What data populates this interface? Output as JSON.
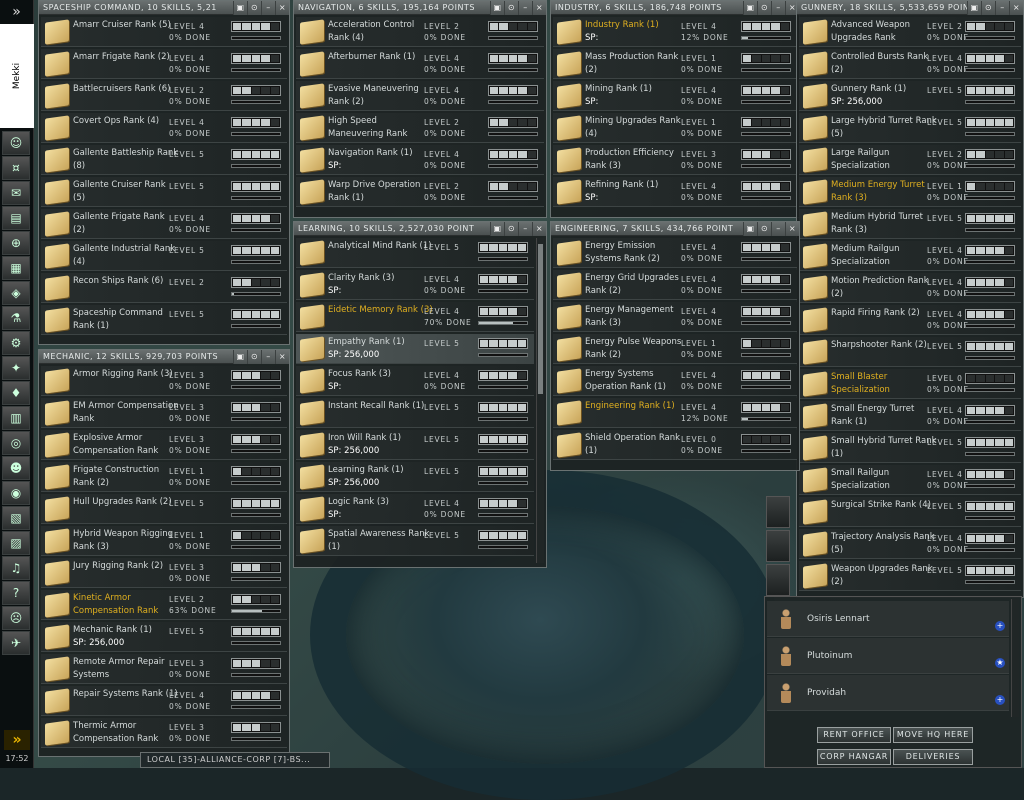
{
  "sidebar": {
    "expand_label": "»",
    "character": "Mekki",
    "clock": "17:52",
    "icons": [
      "character-sheet-icon",
      "wallet-icon",
      "mail-icon",
      "notepad-icon",
      "map-icon",
      "assets-icon",
      "market-icon",
      "science-icon",
      "fitting-icon",
      "contracts-icon",
      "corporation-icon",
      "calculator-icon",
      "help-ring-icon",
      "people-icon",
      "browser-icon",
      "journal-icon",
      "journal2-icon",
      "audio-icon",
      "help-icon",
      "portrait-icon",
      "ship-icon"
    ]
  },
  "windows": {
    "spaceship": {
      "title": "SPACESHIP COMMAND, 10 SKILLS, 5,21",
      "skills": [
        {
          "name": "Amarr Cruiser Rank (5)",
          "level": "LEVEL 4",
          "done": "0% DONE",
          "lv": 4,
          "pct": 0
        },
        {
          "name": "Amarr Frigate Rank (2)",
          "level": "LEVEL 4",
          "done": "0% DONE",
          "lv": 4,
          "pct": 0
        },
        {
          "name": "Battlecruisers Rank (6)",
          "level": "LEVEL 2",
          "done": "0% DONE",
          "lv": 2,
          "pct": 0
        },
        {
          "name": "Covert Ops Rank (4)",
          "level": "LEVEL 4",
          "done": "0% DONE",
          "lv": 4,
          "pct": 0
        },
        {
          "name": "Gallente Battleship Rank (8)",
          "level": "LEVEL 5",
          "done": "",
          "lv": 5,
          "pct": 0
        },
        {
          "name": "Gallente Cruiser Rank (5)",
          "level": "LEVEL 5",
          "done": "",
          "lv": 5,
          "pct": 0
        },
        {
          "name": "Gallente Frigate Rank (2)",
          "level": "LEVEL 4",
          "done": "0% DONE",
          "lv": 4,
          "pct": 0
        },
        {
          "name": "Gallente Industrial Rank (4)",
          "level": "LEVEL 5",
          "done": "",
          "lv": 5,
          "pct": 0
        },
        {
          "name": "Recon Ships Rank (6)",
          "level": "LEVEL 2",
          "done": "",
          "lv": 2,
          "pct": 5
        },
        {
          "name": "Spaceship Command Rank (1)",
          "level": "LEVEL 5",
          "done": "",
          "lv": 5,
          "pct": 0
        }
      ]
    },
    "navigation": {
      "title": "NAVIGATION, 6 SKILLS, 195,164 POINTS",
      "skills": [
        {
          "name": "Acceleration Control Rank (4)",
          "level": "LEVEL 2",
          "done": "0% DONE",
          "lv": 2,
          "pct": 0
        },
        {
          "name": "Afterburner Rank (1)",
          "level": "LEVEL 4",
          "done": "0% DONE",
          "lv": 4,
          "pct": 0
        },
        {
          "name": "Evasive Maneuvering Rank (2)",
          "level": "LEVEL 4",
          "done": "0% DONE",
          "lv": 4,
          "pct": 0
        },
        {
          "name": "High Speed Maneuvering Rank",
          "level": "LEVEL 2",
          "done": "0% DONE",
          "lv": 2,
          "pct": 0
        },
        {
          "name": "Navigation Rank (1)",
          "sp": "SP:",
          "level": "LEVEL 4",
          "done": "0% DONE",
          "lv": 4,
          "pct": 0
        },
        {
          "name": "Warp Drive Operation Rank (1)",
          "level": "LEVEL 2",
          "done": "0% DONE",
          "lv": 2,
          "pct": 0
        }
      ]
    },
    "industry": {
      "title": "INDUSTRY, 6 SKILLS, 186,748 POINTS",
      "skills": [
        {
          "name": "Industry Rank (1)",
          "sp": "SP:",
          "level": "LEVEL 4",
          "done": "12% DONE",
          "lv": 4,
          "pct": 12,
          "hl": true
        },
        {
          "name": "Mass Production Rank (2)",
          "level": "LEVEL 1",
          "done": "0% DONE",
          "lv": 1,
          "pct": 0
        },
        {
          "name": "Mining Rank (1)",
          "sp": "SP:",
          "level": "LEVEL 4",
          "done": "0% DONE",
          "lv": 4,
          "pct": 0
        },
        {
          "name": "Mining Upgrades Rank (4)",
          "level": "LEVEL 1",
          "done": "0% DONE",
          "lv": 1,
          "pct": 0
        },
        {
          "name": "Production Efficiency Rank (3)",
          "level": "LEVEL 3",
          "done": "0% DONE",
          "lv": 3,
          "pct": 0
        },
        {
          "name": "Refining Rank (1)",
          "sp": "SP:",
          "level": "LEVEL 4",
          "done": "0% DONE",
          "lv": 4,
          "pct": 0
        }
      ]
    },
    "gunnery": {
      "title": "GUNNERY, 18 SKILLS, 5,533,659 POINTS",
      "skills": [
        {
          "name": "Advanced Weapon Upgrades Rank",
          "level": "LEVEL 2",
          "done": "0% DONE",
          "lv": 2,
          "pct": 0
        },
        {
          "name": "Controlled Bursts Rank (2)",
          "level": "LEVEL 4",
          "done": "0% DONE",
          "lv": 4,
          "pct": 0
        },
        {
          "name": "Gunnery Rank (1)",
          "sp": "SP: 256,000",
          "level": "LEVEL 5",
          "done": "",
          "lv": 5,
          "pct": 0
        },
        {
          "name": "Large Hybrid Turret Rank (5)",
          "level": "LEVEL 5",
          "done": "",
          "lv": 5,
          "pct": 0
        },
        {
          "name": "Large Railgun Specialization",
          "level": "LEVEL 2",
          "done": "0% DONE",
          "lv": 2,
          "pct": 0
        },
        {
          "name": "Medium Energy Turret Rank (3)",
          "level": "LEVEL 1",
          "done": "0% DONE",
          "lv": 1,
          "pct": 0,
          "hl": true
        },
        {
          "name": "Medium Hybrid Turret Rank (3)",
          "level": "LEVEL 5",
          "done": "",
          "lv": 5,
          "pct": 0
        },
        {
          "name": "Medium Railgun Specialization",
          "level": "LEVEL 4",
          "done": "0% DONE",
          "lv": 4,
          "pct": 0
        },
        {
          "name": "Motion Prediction Rank (2)",
          "level": "LEVEL 4",
          "done": "0% DONE",
          "lv": 4,
          "pct": 0
        },
        {
          "name": "Rapid Firing Rank (2)",
          "level": "LEVEL 4",
          "done": "0% DONE",
          "lv": 4,
          "pct": 0
        },
        {
          "name": "Sharpshooter Rank (2)",
          "level": "LEVEL 5",
          "done": "",
          "lv": 5,
          "pct": 0
        },
        {
          "name": "Small Blaster Specialization",
          "level": "LEVEL 0",
          "done": "0% DONE",
          "lv": 0,
          "pct": 0,
          "hl": true
        },
        {
          "name": "Small Energy Turret Rank (1)",
          "level": "LEVEL 4",
          "done": "0% DONE",
          "lv": 4,
          "pct": 0
        },
        {
          "name": "Small Hybrid Turret Rank (1)",
          "level": "LEVEL 5",
          "done": "",
          "lv": 5,
          "pct": 0
        },
        {
          "name": "Small Railgun Specialization",
          "level": "LEVEL 4",
          "done": "0% DONE",
          "lv": 4,
          "pct": 0
        },
        {
          "name": "Surgical Strike Rank (4)",
          "level": "LEVEL 5",
          "done": "",
          "lv": 5,
          "pct": 0
        },
        {
          "name": "Trajectory Analysis Rank (5)",
          "level": "LEVEL 4",
          "done": "0% DONE",
          "lv": 4,
          "pct": 0
        },
        {
          "name": "Weapon Upgrades Rank (2)",
          "level": "LEVEL 5",
          "done": "",
          "lv": 5,
          "pct": 0
        }
      ]
    },
    "learning": {
      "title": "LEARNING, 10 SKILLS, 2,527,030 POINT",
      "skills": [
        {
          "name": "Analytical Mind Rank (1)",
          "level": "LEVEL 5",
          "done": "",
          "lv": 5,
          "pct": 0
        },
        {
          "name": "Clarity Rank (3)",
          "sp": "SP:",
          "level": "LEVEL 4",
          "done": "0% DONE",
          "lv": 4,
          "pct": 0
        },
        {
          "name": "Eidetic Memory Rank (3)",
          "level": "LEVEL 4",
          "done": "70% DONE",
          "lv": 4,
          "pct": 70,
          "hl": true
        },
        {
          "name": "Empathy Rank (1)",
          "sp": "SP: 256,000",
          "level": "LEVEL 5",
          "done": "",
          "lv": 5,
          "pct": 0,
          "sel": true
        },
        {
          "name": "Focus Rank (3)",
          "sp": "SP:",
          "level": "LEVEL 4",
          "done": "0% DONE",
          "lv": 4,
          "pct": 0
        },
        {
          "name": "Instant Recall Rank (1)",
          "level": "LEVEL 5",
          "done": "",
          "lv": 5,
          "pct": 0
        },
        {
          "name": "Iron Will Rank (1)",
          "sp": "SP: 256,000",
          "level": "LEVEL 5",
          "done": "",
          "lv": 5,
          "pct": 0
        },
        {
          "name": "Learning Rank (1)",
          "sp": "SP: 256,000",
          "level": "LEVEL 5",
          "done": "",
          "lv": 5,
          "pct": 0
        },
        {
          "name": "Logic Rank (3)",
          "sp": "SP:",
          "level": "LEVEL 4",
          "done": "0% DONE",
          "lv": 4,
          "pct": 0
        },
        {
          "name": "Spatial Awareness Rank (1)",
          "level": "LEVEL 5",
          "done": "",
          "lv": 5,
          "pct": 0
        }
      ]
    },
    "engineering": {
      "title": "ENGINEERING, 7 SKILLS, 434,766 POINT",
      "skills": [
        {
          "name": "Energy Emission Systems Rank (2)",
          "level": "LEVEL 4",
          "done": "0% DONE",
          "lv": 4,
          "pct": 0
        },
        {
          "name": "Energy Grid Upgrades Rank (2)",
          "level": "LEVEL 4",
          "done": "0% DONE",
          "lv": 4,
          "pct": 0
        },
        {
          "name": "Energy Management Rank (3)",
          "level": "LEVEL 4",
          "done": "0% DONE",
          "lv": 4,
          "pct": 0
        },
        {
          "name": "Energy Pulse Weapons Rank (2)",
          "level": "LEVEL 1",
          "done": "0% DONE",
          "lv": 1,
          "pct": 0
        },
        {
          "name": "Energy Systems Operation Rank (1)",
          "level": "LEVEL 4",
          "done": "0% DONE",
          "lv": 4,
          "pct": 0
        },
        {
          "name": "Engineering Rank (1)",
          "level": "LEVEL 4",
          "done": "12% DONE",
          "lv": 4,
          "pct": 12,
          "hl": true
        },
        {
          "name": "Shield Operation Rank (1)",
          "level": "LEVEL 0",
          "done": "0% DONE",
          "lv": 0,
          "pct": 0
        }
      ]
    },
    "mechanic": {
      "title": "MECHANIC, 12 SKILLS, 929,703 POINTS",
      "skills": [
        {
          "name": "Armor Rigging Rank (3)",
          "level": "LEVEL 3",
          "done": "0% DONE",
          "lv": 3,
          "pct": 0
        },
        {
          "name": "EM Armor Compensation Rank",
          "level": "LEVEL 3",
          "done": "0% DONE",
          "lv": 3,
          "pct": 0
        },
        {
          "name": "Explosive Armor Compensation Rank",
          "level": "LEVEL 3",
          "done": "0% DONE",
          "lv": 3,
          "pct": 0
        },
        {
          "name": "Frigate Construction Rank (2)",
          "level": "LEVEL 1",
          "done": "0% DONE",
          "lv": 1,
          "pct": 0
        },
        {
          "name": "Hull Upgrades Rank (2)",
          "level": "LEVEL 5",
          "done": "",
          "lv": 5,
          "pct": 0
        },
        {
          "name": "Hybrid Weapon Rigging Rank (3)",
          "level": "LEVEL 1",
          "done": "0% DONE",
          "lv": 1,
          "pct": 0
        },
        {
          "name": "Jury Rigging Rank (2)",
          "level": "LEVEL 3",
          "done": "0% DONE",
          "lv": 3,
          "pct": 0
        },
        {
          "name": "Kinetic Armor Compensation Rank",
          "level": "LEVEL 2",
          "done": "63% DONE",
          "lv": 2,
          "pct": 63,
          "hl": true
        },
        {
          "name": "Mechanic Rank (1)",
          "sp": "SP: 256,000",
          "level": "LEVEL 5",
          "done": "",
          "lv": 5,
          "pct": 0
        },
        {
          "name": "Remote Armor Repair Systems",
          "level": "LEVEL 3",
          "done": "0% DONE",
          "lv": 3,
          "pct": 0
        },
        {
          "name": "Repair Systems Rank (1)",
          "level": "LEVEL 4",
          "done": "0% DONE",
          "lv": 4,
          "pct": 0
        },
        {
          "name": "Thermic Armor Compensation Rank",
          "level": "LEVEL 3",
          "done": "0% DONE",
          "lv": 3,
          "pct": 0
        }
      ]
    }
  },
  "corp": {
    "members": [
      "Osiris Lennart",
      "Plutoinum",
      "Providah"
    ],
    "buttons": {
      "rent": "RENT OFFICE",
      "move": "MOVE HQ HERE",
      "hangar": "CORP HANGAR",
      "deliveries": "DELIVERIES"
    }
  },
  "chat": {
    "tabs": "LOCAL [35]-ALLIANCE-CORP [7]-BS..."
  },
  "window_buttons": [
    "▣",
    "⊙",
    "–",
    "×"
  ]
}
